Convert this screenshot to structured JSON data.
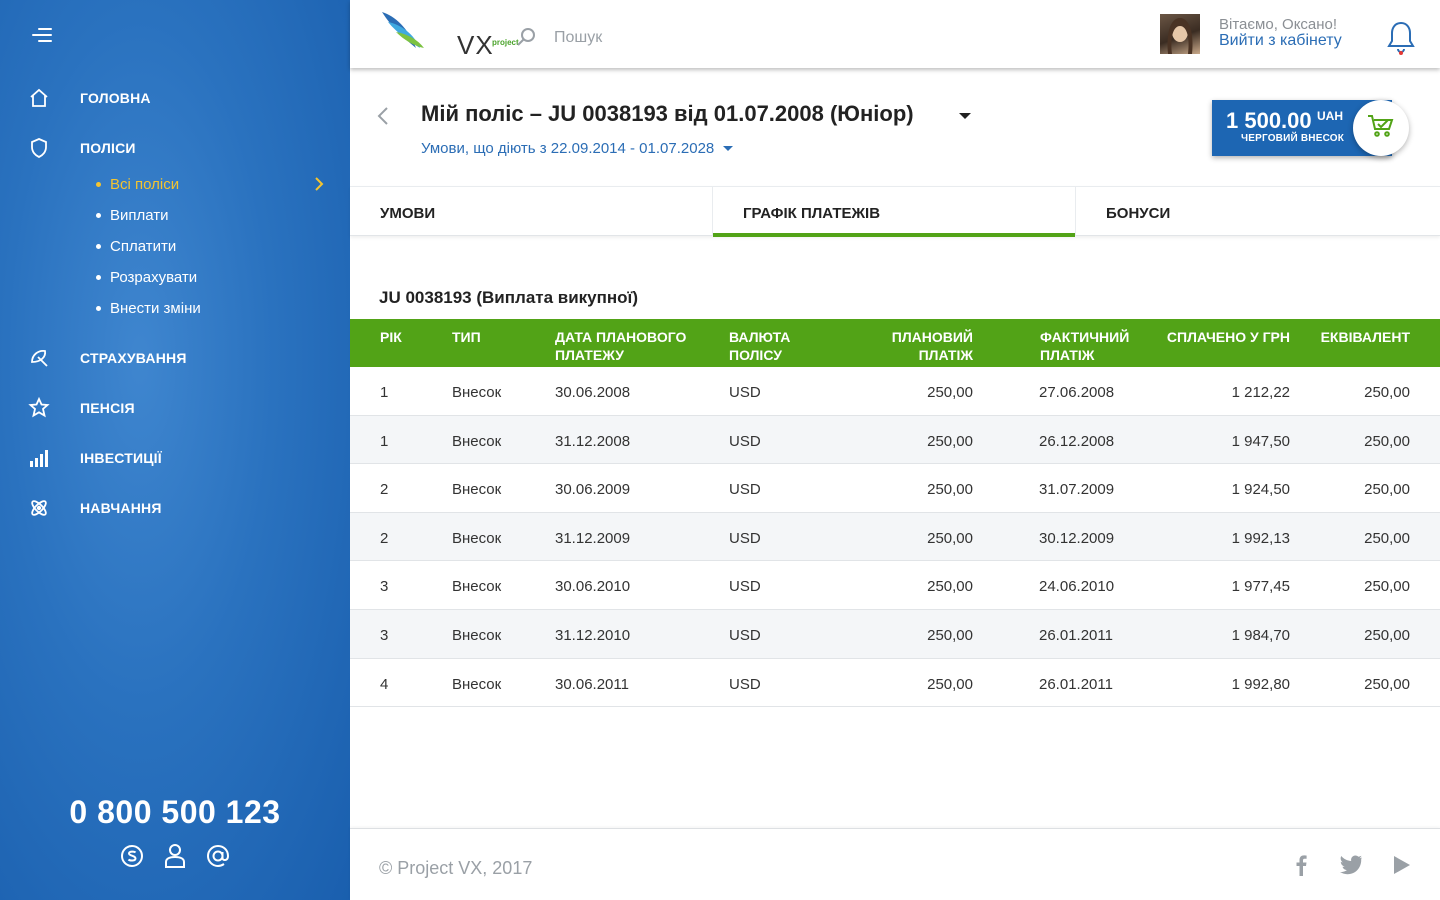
{
  "sidebar": {
    "menu_icon": "hamburger-icon",
    "items": [
      {
        "label": "ГОЛОВНА",
        "icon": "home-icon"
      },
      {
        "label": "ПОЛІСИ",
        "icon": "shield-icon"
      },
      {
        "label": "СТРАХУВАННЯ",
        "icon": "umbrella-icon"
      },
      {
        "label": "ПЕНСІЯ",
        "icon": "flower-icon"
      },
      {
        "label": "ІНВЕСТИЦІЇ",
        "icon": "bar-chart-icon"
      },
      {
        "label": "НАВЧАННЯ",
        "icon": "atom-icon"
      }
    ],
    "sub_items": [
      {
        "label": "Всі поліси",
        "active": true
      },
      {
        "label": "Виплати"
      },
      {
        "label": "Сплатити"
      },
      {
        "label": "Розрахувати"
      },
      {
        "label": "Внести зміни"
      }
    ],
    "phone": "0 800 500 123",
    "contact_icons": [
      "skype-icon",
      "user-icon",
      "at-icon"
    ],
    "accent_color": "#f4c430"
  },
  "header": {
    "logo_text": "VX",
    "logo_sub": "project",
    "search_placeholder": "Пошук",
    "greeting": "Вітаємо, Оксано!",
    "logout": "Вийти з кабінету"
  },
  "policy": {
    "title": "Мій поліс – JU 0038193 від 01.07.2008 (Юніор)",
    "conditions": "Умови, що діють з 22.09.2014 - 01.07.2028",
    "payment_amount": "1 500.00",
    "payment_currency": "UAH",
    "payment_label": "ЧЕРГОВИЙ ВНЕСОК"
  },
  "tabs": [
    {
      "label": "УМОВИ"
    },
    {
      "label": "ГРАФІК ПЛАТЕЖІВ",
      "active": true
    },
    {
      "label": "БОНУСИ"
    }
  ],
  "table": {
    "title": "JU 0038193 (Виплата викупної)",
    "columns": [
      "РІК",
      "ТИП",
      "ДАТА ПЛАНОВОГО ПЛАТЕЖУ",
      "ВАЛЮТА ПОЛІСУ",
      "ПЛАНОВИЙ ПЛАТІЖ",
      "ФАКТИЧНИЙ ПЛАТІЖ",
      "СПЛАЧЕНО У ГРН",
      "ЕКВІВАЛЕНТ"
    ],
    "rows": [
      [
        "1",
        "Внесок",
        "30.06.2008",
        "USD",
        "250,00",
        "27.06.2008",
        "1 212,22",
        "250,00"
      ],
      [
        "1",
        "Внесок",
        "31.12.2008",
        "USD",
        "250,00",
        "26.12.2008",
        "1 947,50",
        "250,00"
      ],
      [
        "2",
        "Внесок",
        "30.06.2009",
        "USD",
        "250,00",
        "31.07.2009",
        "1 924,50",
        "250,00"
      ],
      [
        "2",
        "Внесок",
        "31.12.2009",
        "USD",
        "250,00",
        "30.12.2009",
        "1 992,13",
        "250,00"
      ],
      [
        "3",
        "Внесок",
        "30.06.2010",
        "USD",
        "250,00",
        "24.06.2010",
        "1 977,45",
        "250,00"
      ],
      [
        "3",
        "Внесок",
        "31.12.2010",
        "USD",
        "250,00",
        "26.01.2011",
        "1 984,70",
        "250,00"
      ],
      [
        "4",
        "Внесок",
        "30.06.2011",
        "USD",
        "250,00",
        "26.01.2011",
        "1 992,80",
        "250,00"
      ]
    ],
    "header_color": "#52a317"
  },
  "footer": {
    "copyright": "© Project VX, 2017",
    "social_icons": [
      "facebook-icon",
      "twitter-icon",
      "youtube-icon"
    ]
  }
}
